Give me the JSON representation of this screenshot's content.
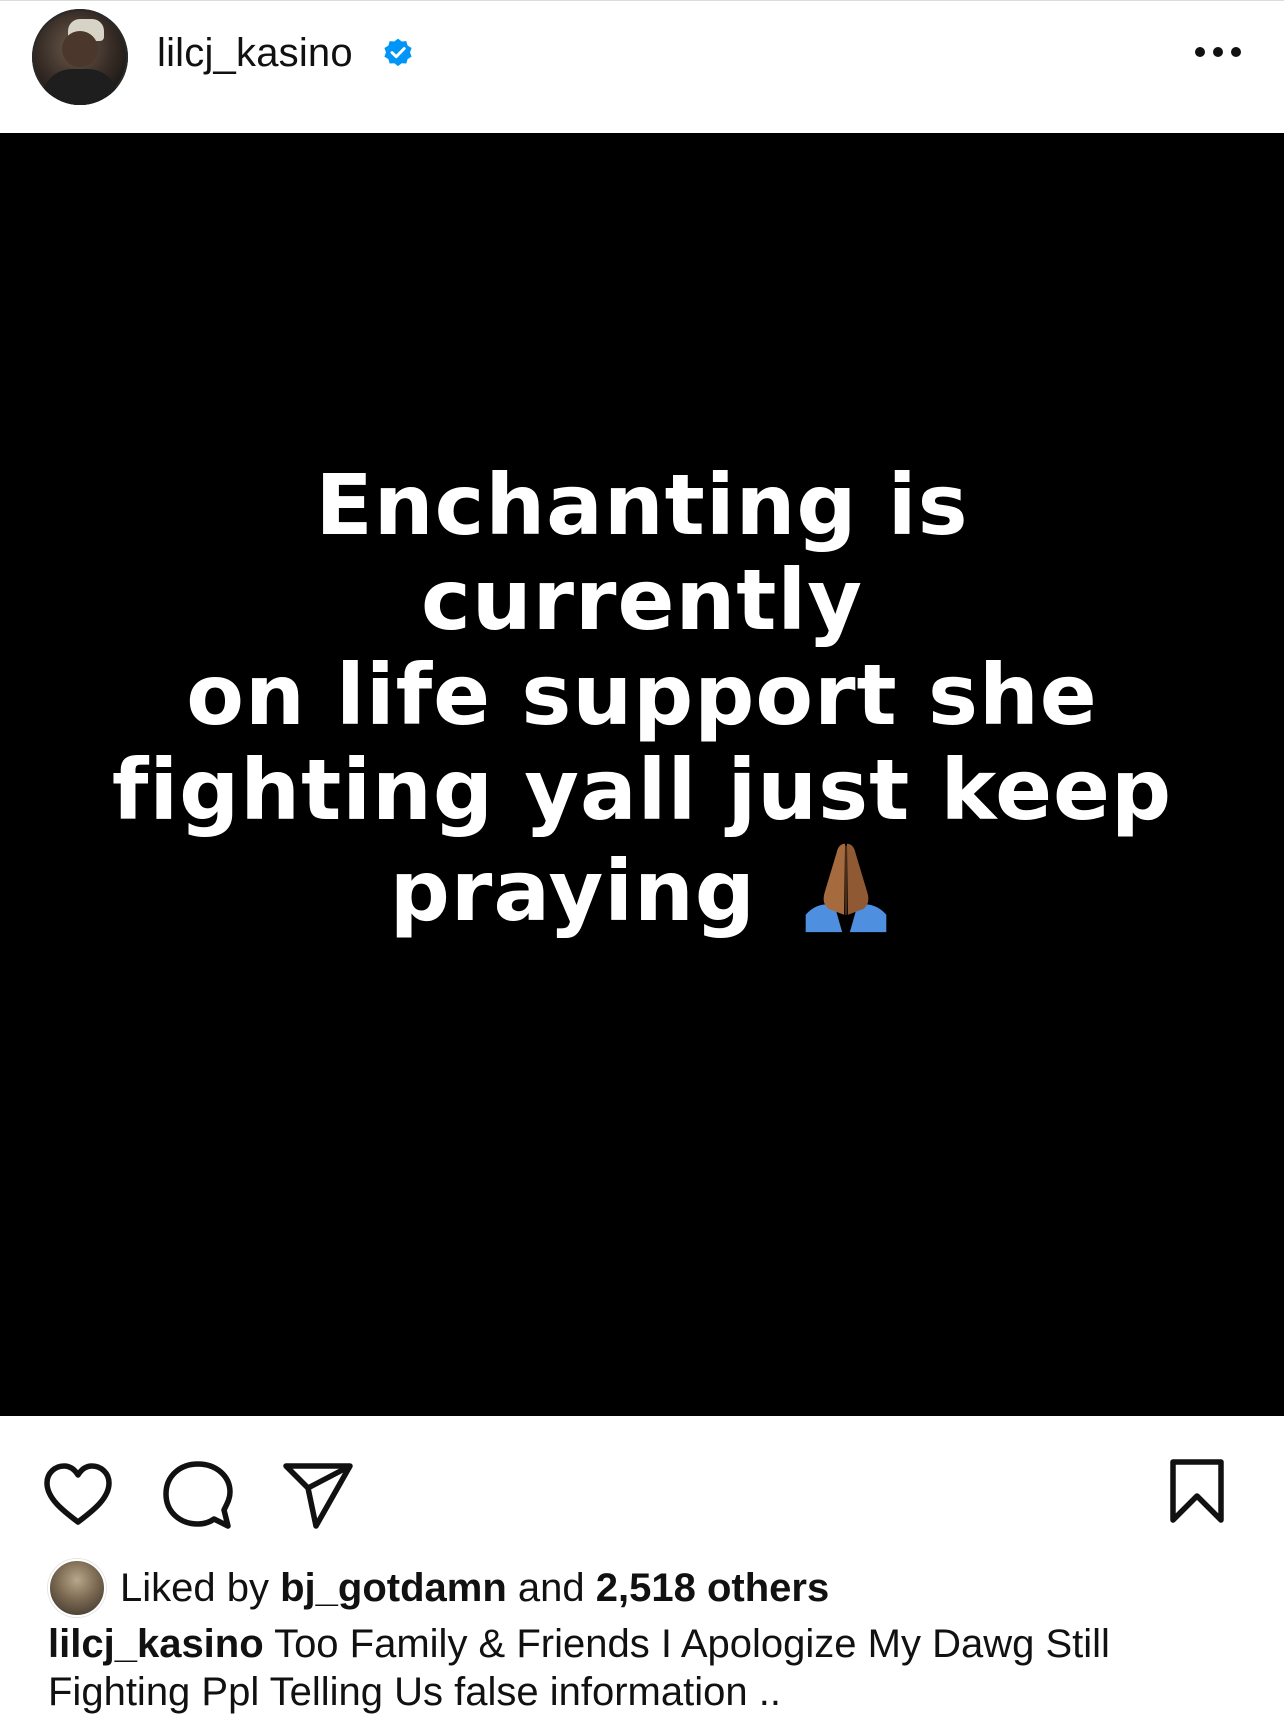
{
  "header": {
    "username": "lilcj_kasino",
    "verified": true,
    "more_icon": "more-horizontal-icon"
  },
  "post": {
    "text_line_1": "Enchanting is currently",
    "text_line_2": "on life support she",
    "text_line_3": "fighting yall just keep",
    "text_line_4": "praying",
    "emoji": "praying-hands-emoji",
    "background": "#000000",
    "text_color": "#ffffff"
  },
  "actions": {
    "like_icon": "heart-icon",
    "comment_icon": "comment-icon",
    "share_icon": "send-icon",
    "save_icon": "bookmark-icon"
  },
  "likes": {
    "prefix": "Liked by",
    "liker": "bj_gotdamn",
    "and": "and",
    "others": "2,518 others"
  },
  "caption": {
    "username": "lilcj_kasino",
    "text": "Too Family & Friends I Apologize My Dawg Still Fighting Ppl Telling Us false information .."
  },
  "colors": {
    "verified_blue": "#0095f6",
    "text": "#111111",
    "divider": "#dbdbdb"
  }
}
